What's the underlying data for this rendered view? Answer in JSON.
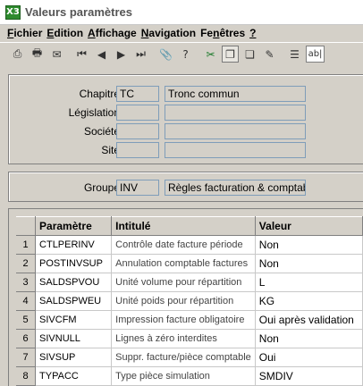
{
  "window": {
    "title": "Valeurs paramètres",
    "app_icon_text": "X3"
  },
  "menu": [
    {
      "label": "Fichier",
      "accel": "F",
      "rest": "ichier"
    },
    {
      "label": "Edition",
      "accel": "E",
      "rest": "dition"
    },
    {
      "label": "Affichage",
      "accel": "A",
      "rest": "ffichage"
    },
    {
      "label": "Navigation",
      "accel": "N",
      "rest": "avigation"
    },
    {
      "label": "Fenêtres",
      "accel": "n",
      "pre": "Fe",
      "rest": "êtres"
    },
    {
      "label": "?",
      "accel": "?",
      "rest": ""
    }
  ],
  "toolbar": {
    "buttons": [
      {
        "name": "save-icon",
        "glyph": "⎙"
      },
      {
        "name": "print-icon",
        "glyph": "🖶"
      },
      {
        "name": "mail-icon",
        "glyph": "✉"
      },
      {
        "name": "first-record-icon",
        "glyph": "⏮"
      },
      {
        "name": "previous-record-icon",
        "glyph": "◀"
      },
      {
        "name": "next-record-icon",
        "glyph": "▶"
      },
      {
        "name": "last-record-icon",
        "glyph": "⏭"
      },
      {
        "name": "attachment-icon",
        "glyph": "📎"
      },
      {
        "name": "help-icon",
        "glyph": "?"
      },
      {
        "name": "tools-icon",
        "glyph": "✂"
      },
      {
        "name": "window-icon",
        "glyph": "❐"
      },
      {
        "name": "copy-window-icon",
        "glyph": "❏"
      },
      {
        "name": "brush-icon",
        "glyph": "✎"
      },
      {
        "name": "list-icon",
        "glyph": "☰"
      },
      {
        "name": "text-icon",
        "glyph": "ab|"
      }
    ]
  },
  "header_fields": [
    {
      "label": "Chapitre",
      "code": "TC",
      "description": "Tronc commun"
    },
    {
      "label": "Législation",
      "code": "",
      "description": ""
    },
    {
      "label": "Société",
      "code": "",
      "description": ""
    },
    {
      "label": "Site",
      "code": "",
      "description": ""
    }
  ],
  "group_field": {
    "label": "Groupe",
    "code": "INV",
    "description": "Règles facturation & comptable"
  },
  "grid": {
    "columns": [
      "",
      "Paramètre",
      "Intitulé",
      "Valeur"
    ],
    "rows": [
      {
        "num": "1",
        "param": "CTLPERINV",
        "desc": "Contrôle date facture période",
        "value": "Non"
      },
      {
        "num": "2",
        "param": "POSTINVSUP",
        "desc": "Annulation comptable factures",
        "value": "Non"
      },
      {
        "num": "3",
        "param": "SALDSPVOU",
        "desc": "Unité volume pour répartition",
        "value": "L"
      },
      {
        "num": "4",
        "param": "SALDSPWEU",
        "desc": "Unité poids pour répartition",
        "value": "KG"
      },
      {
        "num": "5",
        "param": "SIVCFM",
        "desc": "Impression facture obligatoire",
        "value": "Oui après validation"
      },
      {
        "num": "6",
        "param": "SIVNULL",
        "desc": "Lignes à zéro interdites",
        "value": "Non"
      },
      {
        "num": "7",
        "param": "SIVSUP",
        "desc": "Suppr. facture/pièce comptable",
        "value": "Oui"
      },
      {
        "num": "8",
        "param": "TYPACC",
        "desc": "Type pièce simulation",
        "value": "SMDIV"
      }
    ]
  }
}
